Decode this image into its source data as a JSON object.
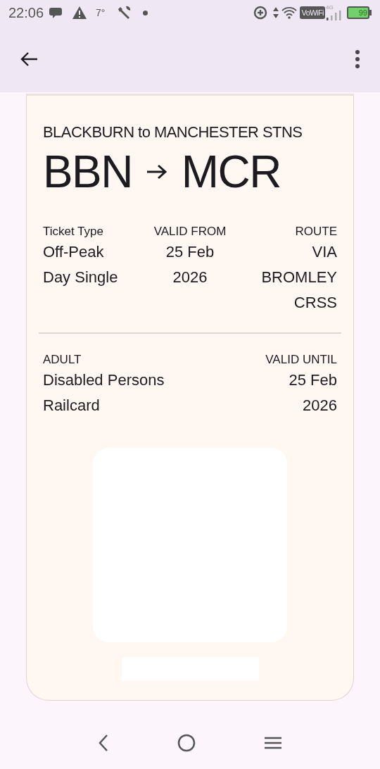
{
  "status_bar": {
    "time": "22:06",
    "temperature": "7°",
    "vowifi": "VoWiFi",
    "network": "4G",
    "battery": "99"
  },
  "ticket": {
    "journey": "BLACKBURN to MANCHESTER STNS",
    "origin": "BBN",
    "destination": "MCR",
    "details": [
      {
        "label": "Ticket Type",
        "value": "Off-Peak Day Single"
      },
      {
        "label": "VALID FROM",
        "value": "25 Feb 2026"
      },
      {
        "label": "ROUTE",
        "value": "VIA BROMLEY CRSS"
      }
    ],
    "passenger": {
      "label": "ADULT",
      "value": "Disabled Persons Railcard"
    },
    "valid_until": {
      "label": "VALID UNTIL",
      "value": "25 Feb 2026"
    }
  }
}
